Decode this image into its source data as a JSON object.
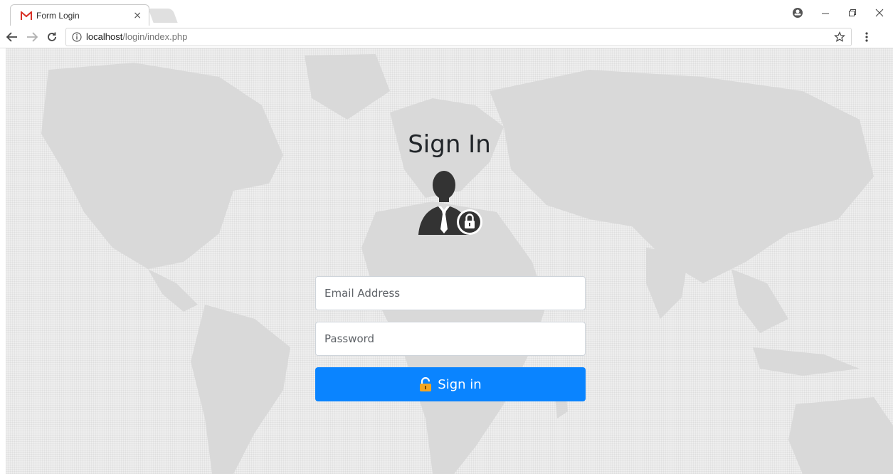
{
  "browser": {
    "tab_title": "Form Login",
    "tab_close": "×",
    "url_host": "localhost",
    "url_path": "/login/index.php",
    "icons": {
      "favicon": "gmail-m-icon",
      "back": "back-arrow-icon",
      "forward": "forward-arrow-icon",
      "reload": "reload-icon",
      "info": "info-icon",
      "bookmark": "star-icon",
      "menu": "kebab-menu-icon",
      "profile": "profile-icon",
      "minimize": "minimize-icon",
      "restore": "restore-icon",
      "close": "close-icon"
    }
  },
  "page": {
    "title": "Sign In",
    "email_placeholder": "Email Address",
    "password_placeholder": "Password",
    "signin_label": "Sign in",
    "colors": {
      "button": "#0a84ff",
      "icon": "#333333",
      "background": "#eeeeee"
    }
  }
}
